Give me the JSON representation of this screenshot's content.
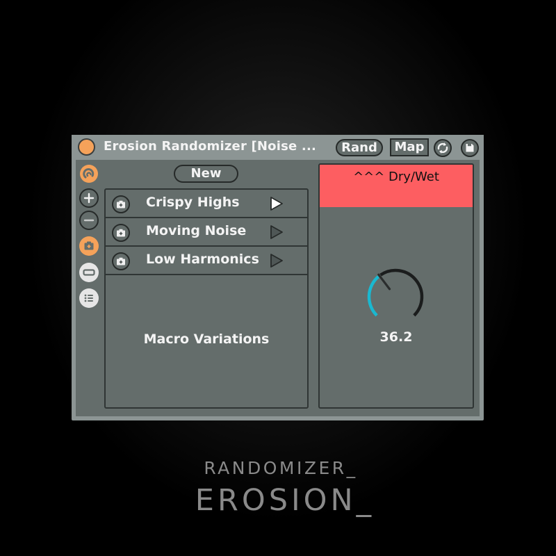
{
  "device": {
    "title": "Erosion Randomizer [Noise ...",
    "power_state": "on",
    "buttons": {
      "rand": "Rand",
      "map": "Map",
      "sync_icon": "sync-icon",
      "save_icon": "save-icon"
    }
  },
  "sidebar": {
    "items": [
      {
        "icon": "logo-swirl-icon",
        "active": true
      },
      {
        "icon": "plus-icon",
        "active": false
      },
      {
        "icon": "minus-icon",
        "active": false
      },
      {
        "icon": "snapshot-add-icon",
        "active": true
      },
      {
        "icon": "remove-bar-icon",
        "active": false
      },
      {
        "icon": "list-icon",
        "active": false
      }
    ]
  },
  "variations": {
    "new_label": "New",
    "items": [
      {
        "label": "Crispy Highs",
        "icon": "snapshot-icon",
        "playing": true
      },
      {
        "label": "Moving Noise",
        "icon": "snapshot-icon",
        "playing": false
      },
      {
        "label": "Low Harmonics",
        "icon": "snapshot-icon",
        "playing": false
      }
    ],
    "panel_label": "Macro Variations"
  },
  "macro": {
    "title": "^^^ Dry/Wet",
    "value": "36.2",
    "value_numeric": 36.2,
    "range": [
      0,
      100
    ],
    "header_color": "#fd5e61",
    "arc_color": "#1ab8d0"
  },
  "branding": {
    "subtitle": "RANDOMIZER_",
    "title": "EROSION_"
  },
  "colors": {
    "accent_orange": "#f5a25a",
    "panel_bg": "#646d6b",
    "frame_bg": "#8c9594"
  }
}
